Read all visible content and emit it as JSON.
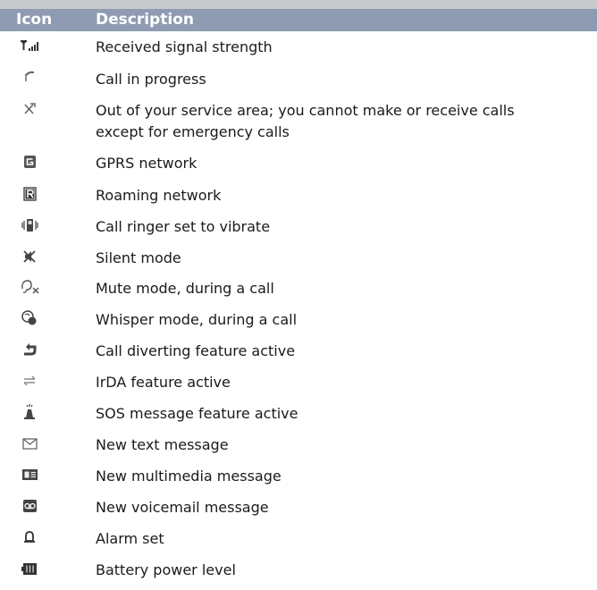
{
  "header": {
    "icon_col": "Icon",
    "description_col": "Description"
  },
  "colors": {
    "header_bg": "#8f9bb3",
    "header_text": "#ffffff",
    "top_bar": "#c7c9cc",
    "icon_color": "#333333"
  },
  "rows": [
    {
      "icon": "signal-strength-icon",
      "lines": [
        "Received signal strength"
      ]
    },
    {
      "icon": "call-in-progress-icon",
      "lines": [
        "Call in progress"
      ]
    },
    {
      "icon": "no-service-icon",
      "lines": [
        "Out of your service area; you cannot make or receive calls",
        "except for emergency calls"
      ]
    },
    {
      "icon": "gprs-icon",
      "lines": [
        "GPRS network"
      ]
    },
    {
      "icon": "roaming-icon",
      "lines": [
        "Roaming network"
      ]
    },
    {
      "icon": "vibrate-icon",
      "lines": [
        "Call ringer set to vibrate"
      ]
    },
    {
      "icon": "silent-mode-icon",
      "lines": [
        "Silent mode"
      ]
    },
    {
      "icon": "mute-icon",
      "lines": [
        "Mute mode, during a call"
      ]
    },
    {
      "icon": "whisper-icon",
      "lines": [
        "Whisper mode, during a call"
      ]
    },
    {
      "icon": "call-divert-icon",
      "lines": [
        "Call diverting feature active"
      ]
    },
    {
      "icon": "irda-icon",
      "lines": [
        "IrDA feature active"
      ]
    },
    {
      "icon": "sos-icon",
      "lines": [
        "SOS message feature active"
      ]
    },
    {
      "icon": "text-message-icon",
      "lines": [
        "New text message"
      ]
    },
    {
      "icon": "multimedia-message-icon",
      "lines": [
        "New multimedia message"
      ]
    },
    {
      "icon": "voicemail-icon",
      "lines": [
        "New voicemail message"
      ]
    },
    {
      "icon": "alarm-icon",
      "lines": [
        "Alarm set"
      ]
    },
    {
      "icon": "battery-icon",
      "lines": [
        "Battery power level"
      ]
    }
  ]
}
